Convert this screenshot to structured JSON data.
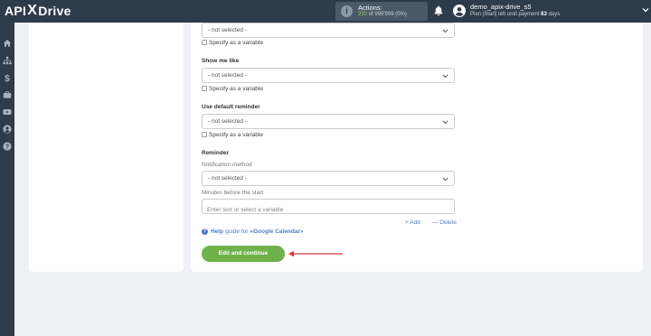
{
  "brand": {
    "part1": "API",
    "part2": "X",
    "part3": "Drive"
  },
  "actions": {
    "label": "Actions:",
    "used": "292",
    "total": "of 999'999",
    "percent": "(0%)"
  },
  "user": {
    "name": "demo_apix-drive_s5",
    "plan_prefix": "Plan |Start| left until payment",
    "days_value": "63",
    "days_suffix": "days"
  },
  "fields": [
    {
      "value": "- not selected -",
      "variable_label": "Specify as a variable"
    },
    {
      "title": "Show me like",
      "value": "- not selected -",
      "variable_label": "Specify as a variable"
    },
    {
      "title": "Use default reminder",
      "value": "- not selected -",
      "variable_label": "Specify as a variable"
    }
  ],
  "reminder": {
    "title": "Reminder",
    "method_label": "Notification method",
    "method_value": "- not selected -",
    "minutes_label": "Minutes before the start",
    "minutes_placeholder": "Enter text or select a variable",
    "add_label": "+ Add",
    "delete_label": "— Delete"
  },
  "help": {
    "prefix": "Help",
    "text": "guide for",
    "service": "«Google Calendar»"
  },
  "continue_label": "Edit and continue",
  "icons": [
    "info-icon",
    "bell-icon",
    "user-icon",
    "home-icon",
    "sitemap-icon",
    "dollar-icon",
    "briefcase-icon",
    "youtube-icon",
    "account-icon",
    "help-icon"
  ],
  "colors": {
    "topbar": "#2e3b4b",
    "accent_green": "#6fb24a",
    "link_blue": "#4b7fc4",
    "arrow_red": "#d9383a"
  }
}
